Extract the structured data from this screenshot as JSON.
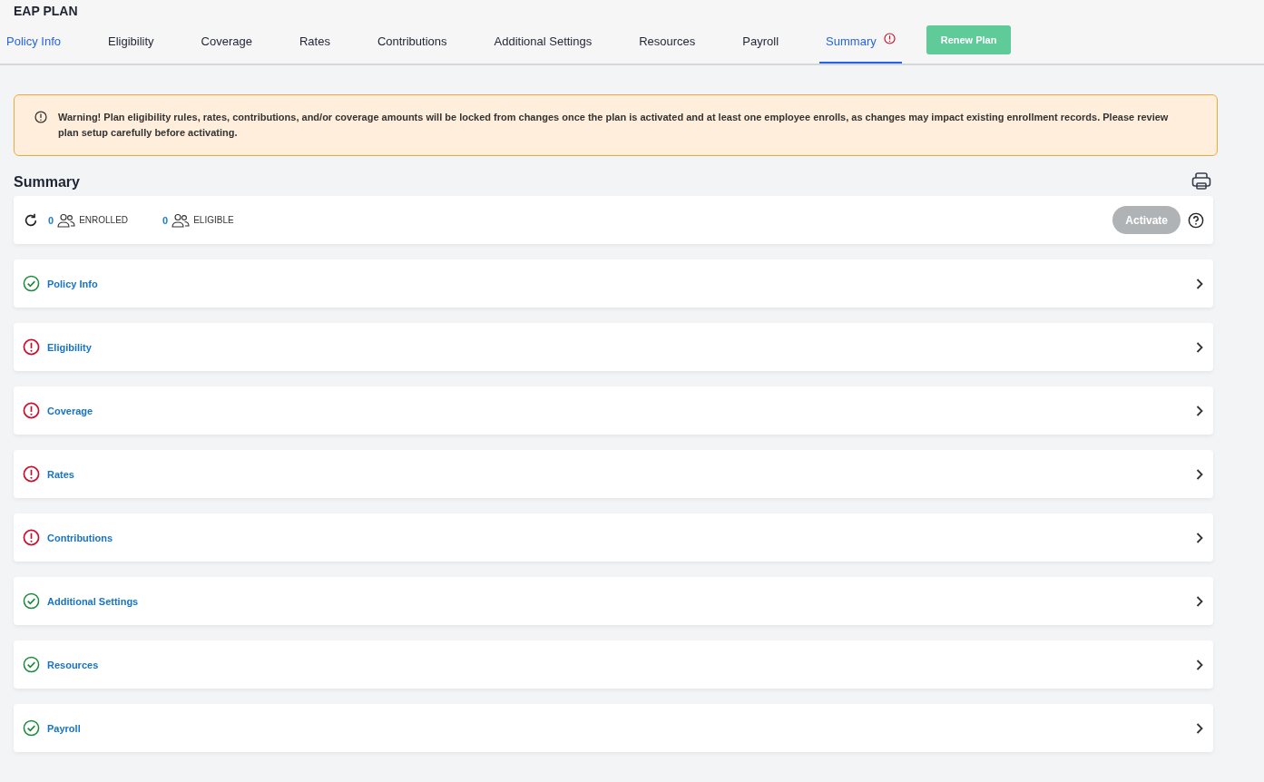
{
  "title": "EAP PLAN",
  "tabs": [
    {
      "label": "Policy Info",
      "selected": false,
      "visited": true,
      "alert": false
    },
    {
      "label": "Eligibility",
      "selected": false,
      "visited": false,
      "alert": false
    },
    {
      "label": "Coverage",
      "selected": false,
      "visited": false,
      "alert": false
    },
    {
      "label": "Rates",
      "selected": false,
      "visited": false,
      "alert": false
    },
    {
      "label": "Contributions",
      "selected": false,
      "visited": false,
      "alert": false
    },
    {
      "label": "Additional Settings",
      "selected": false,
      "visited": false,
      "alert": false
    },
    {
      "label": "Resources",
      "selected": false,
      "visited": false,
      "alert": false
    },
    {
      "label": "Payroll",
      "selected": false,
      "visited": false,
      "alert": false
    },
    {
      "label": "Summary",
      "selected": true,
      "visited": false,
      "alert": true
    }
  ],
  "renew_button": "Renew Plan",
  "warning": "Warning! Plan eligibility rules, rates, contributions, and/or coverage amounts will be locked from changes once the plan is activated and at least one employee enrolls, as changes may impact existing enrollment records. Please review plan setup carefully before activating.",
  "summary": {
    "heading": "Summary",
    "enrolled_count": "0",
    "enrolled_label": "ENROLLED",
    "eligible_count": "0",
    "eligible_label": "ELIGIBLE",
    "activate_button": "Activate",
    "activate_disabled": true
  },
  "sections": [
    {
      "label": "Policy Info",
      "complete": true
    },
    {
      "label": "Eligibility",
      "complete": false
    },
    {
      "label": "Coverage",
      "complete": false
    },
    {
      "label": "Rates",
      "complete": false
    },
    {
      "label": "Contributions",
      "complete": false
    },
    {
      "label": "Additional Settings",
      "complete": true
    },
    {
      "label": "Resources",
      "complete": true
    },
    {
      "label": "Payroll",
      "complete": true
    }
  ]
}
